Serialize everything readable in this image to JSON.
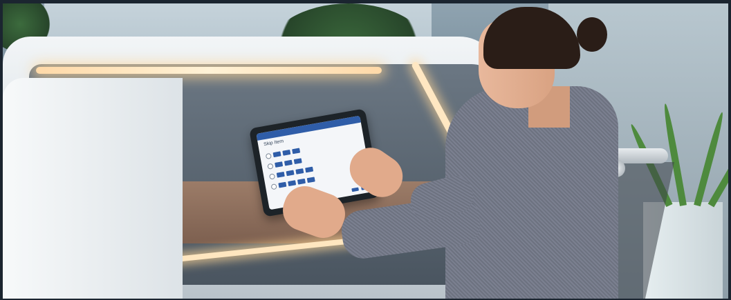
{
  "scene": {
    "subject": "",
    "tablet_screen": {
      "title": "Skip Item",
      "option_rows": [
        {
          "blocks": 3
        },
        {
          "blocks": 3
        },
        {
          "blocks": 4
        },
        {
          "blocks": 4
        }
      ]
    }
  },
  "colors": {
    "accent": "#2f5da8",
    "kiosk_light": "#ffe6bf",
    "jacket": "#737888"
  }
}
